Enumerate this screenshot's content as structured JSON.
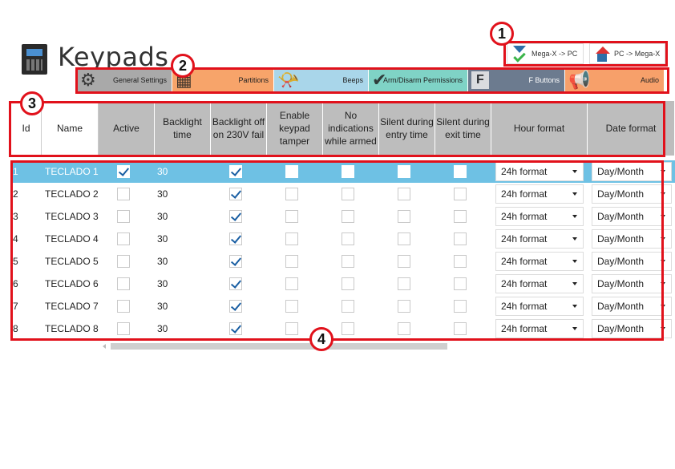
{
  "header": {
    "title": "Keypads"
  },
  "sync": {
    "download_label": "Mega-X -> PC",
    "upload_label": "PC -> Mega-X"
  },
  "tabs": [
    {
      "label": "General Settings",
      "icon": "gears-icon"
    },
    {
      "label": "Partitions",
      "icon": "partitions-icon"
    },
    {
      "label": "Beeps",
      "icon": "horn-icon"
    },
    {
      "label": "Arm/Disarm Permissions",
      "icon": "checkmark-icon"
    },
    {
      "label": "F Buttons",
      "icon": "f-key-icon"
    },
    {
      "label": "Audio",
      "icon": "megaphone-icon"
    }
  ],
  "columns": [
    "Id",
    "Name",
    "Active",
    "Backlight time",
    "Backlight off on 230V fail",
    "Enable keypad tamper",
    "No indications while armed",
    "Silent during entry time",
    "Silent during exit time",
    "Hour format",
    "Date format"
  ],
  "rows": [
    {
      "id": "1",
      "name": "TECLADO  1",
      "active": true,
      "backlight": "30",
      "off230": true,
      "tamper": false,
      "noind": false,
      "silent_entry": false,
      "silent_exit": false,
      "hour": "24h format",
      "date": "Day/Month",
      "selected": true
    },
    {
      "id": "2",
      "name": "TECLADO  2",
      "active": false,
      "backlight": "30",
      "off230": true,
      "tamper": false,
      "noind": false,
      "silent_entry": false,
      "silent_exit": false,
      "hour": "24h format",
      "date": "Day/Month",
      "selected": false
    },
    {
      "id": "3",
      "name": "TECLADO  3",
      "active": false,
      "backlight": "30",
      "off230": true,
      "tamper": false,
      "noind": false,
      "silent_entry": false,
      "silent_exit": false,
      "hour": "24h format",
      "date": "Day/Month",
      "selected": false
    },
    {
      "id": "4",
      "name": "TECLADO  4",
      "active": false,
      "backlight": "30",
      "off230": true,
      "tamper": false,
      "noind": false,
      "silent_entry": false,
      "silent_exit": false,
      "hour": "24h format",
      "date": "Day/Month",
      "selected": false
    },
    {
      "id": "5",
      "name": "TECLADO  5",
      "active": false,
      "backlight": "30",
      "off230": true,
      "tamper": false,
      "noind": false,
      "silent_entry": false,
      "silent_exit": false,
      "hour": "24h format",
      "date": "Day/Month",
      "selected": false
    },
    {
      "id": "6",
      "name": "TECLADO  6",
      "active": false,
      "backlight": "30",
      "off230": true,
      "tamper": false,
      "noind": false,
      "silent_entry": false,
      "silent_exit": false,
      "hour": "24h format",
      "date": "Day/Month",
      "selected": false
    },
    {
      "id": "7",
      "name": "TECLADO  7",
      "active": false,
      "backlight": "30",
      "off230": true,
      "tamper": false,
      "noind": false,
      "silent_entry": false,
      "silent_exit": false,
      "hour": "24h format",
      "date": "Day/Month",
      "selected": false
    },
    {
      "id": "8",
      "name": "TECLADO  8",
      "active": false,
      "backlight": "30",
      "off230": true,
      "tamper": false,
      "noind": false,
      "silent_entry": false,
      "silent_exit": false,
      "hour": "24h format",
      "date": "Day/Month",
      "selected": false
    }
  ],
  "annotations": [
    "1",
    "2",
    "3",
    "4"
  ],
  "colors": {
    "annotation_red": "#e1111b",
    "selected_row": "#6ec1e4",
    "header_grey": "#bdbdbd"
  }
}
